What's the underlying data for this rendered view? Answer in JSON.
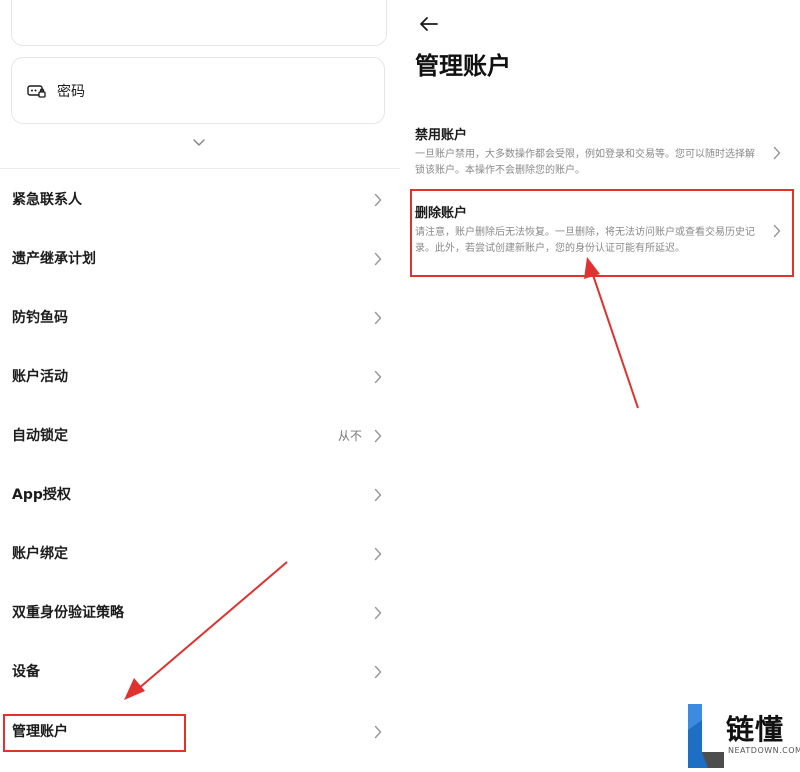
{
  "left": {
    "password_label": "密码",
    "menu": [
      {
        "label": "紧急联系人",
        "value": ""
      },
      {
        "label": "遗产继承计划",
        "value": ""
      },
      {
        "label": "防钓鱼码",
        "value": ""
      },
      {
        "label": "账户活动",
        "value": ""
      },
      {
        "label": "自动锁定",
        "value": "从不"
      },
      {
        "label": "App授权",
        "value": ""
      },
      {
        "label": "账户绑定",
        "value": ""
      },
      {
        "label": "双重身份验证策略",
        "value": ""
      },
      {
        "label": "设备",
        "value": ""
      },
      {
        "label": "管理账户",
        "value": ""
      }
    ]
  },
  "right": {
    "title": "管理账户",
    "disable": {
      "title": "禁用账户",
      "desc": "一旦账户禁用，大多数操作都会受限，例如登录和交易等。您可以随时选择解锁该账户。本操作不会删除您的账户。"
    },
    "delete": {
      "title": "删除账户",
      "desc": "请注意，账户删除后无法恢复。一旦删除，将无法访问账户或查看交易历史记录。此外，若尝试创建新账户，您的身份认证可能有所延迟。"
    }
  },
  "watermark": {
    "brand": "链懂",
    "domain": "NEATDOWN.COM"
  },
  "colors": {
    "annotation_red": "#e0322f",
    "text_primary": "#1b1b1b",
    "text_secondary": "#8a8a8a",
    "watermark_blue": "#1e6fc4"
  }
}
